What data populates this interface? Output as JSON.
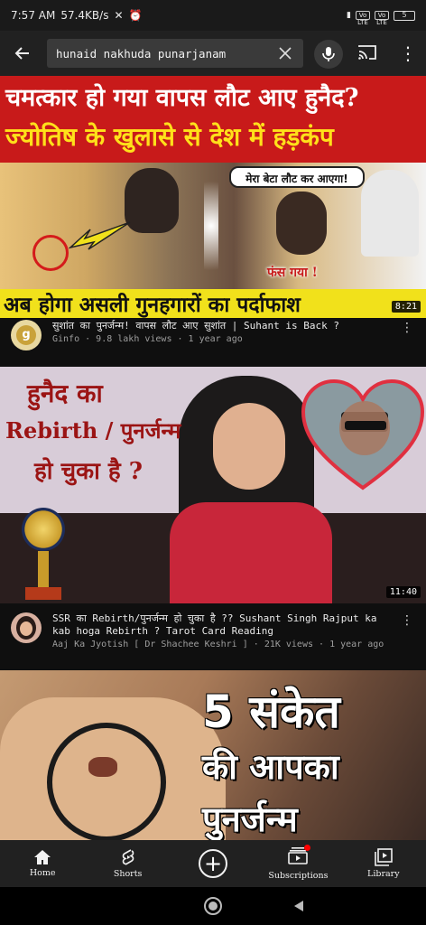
{
  "status_bar": {
    "time": "7:57 AM",
    "speed": "57.4KB/s",
    "signal1": "Vo LTE",
    "signal2": "Vo LTE",
    "battery": "5"
  },
  "search": {
    "query": "hunaid nakhuda punarjanam"
  },
  "results": [
    {
      "thumbnail": {
        "line1": "चमत्कार हो गया वापस लौट आए हुनैद?",
        "line2": "ज्योतिष के खुलासे से देश में हड़कंप",
        "bubble": "मेरा बेटा लौट कर आएगा!",
        "caption": "फंस गया !",
        "bottom": "अब होगा असली गुनहगारों का पर्दाफाश"
      },
      "duration": "8:21",
      "title": "सुशांत का पुनर्जन्म! वापस लौट आए सुशांत | Suhant is Back ?",
      "channel": "Ginfo",
      "views": "9.8  lakh views",
      "age": "1 year ago"
    },
    {
      "thumbnail": {
        "line1": "हुनैद  का",
        "line2": "Rebirth / पुनर्जन्म",
        "line3": "हो चुका है ?"
      },
      "duration": "11:40",
      "title": "SSR का Rebirth/पुनर्जन्म हो चुका है ?? Sushant Singh Rajput ka kab hoga Rebirth ? Tarot Card Reading",
      "channel": "Aaj Ka Jyotish [ Dr Shachee Keshri ]",
      "views": "21K views",
      "age": "1 year ago"
    },
    {
      "thumbnail": {
        "line1": "5 संकेत",
        "line2": "की आपका",
        "line3": "पुनर्जन्म"
      }
    }
  ],
  "bottom_nav": [
    {
      "label": "Home",
      "icon": "home-icon"
    },
    {
      "label": "Shorts",
      "icon": "shorts-icon"
    },
    {
      "label": "",
      "icon": "create-icon"
    },
    {
      "label": "Subscriptions",
      "icon": "subscriptions-icon"
    },
    {
      "label": "Library",
      "icon": "library-icon"
    }
  ],
  "colors": {
    "background": "#0f0f0f",
    "thumb1_red": "#c81a1a",
    "thumb1_yellow": "#f1e11b",
    "notification_dot": "#ff0000"
  }
}
